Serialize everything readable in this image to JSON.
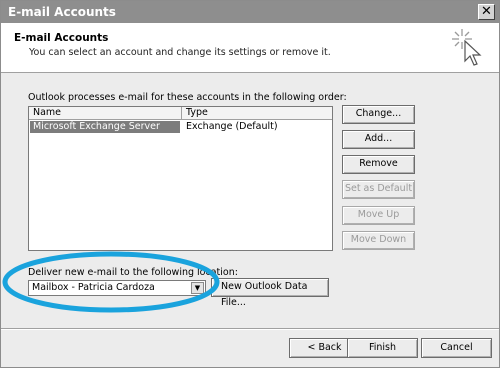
{
  "window": {
    "title": "E-mail Accounts",
    "close_symbol": "✕"
  },
  "header": {
    "title": "E-mail Accounts",
    "subtitle": "You can select an account and change its settings or remove it.",
    "icon": "wizard-sparkle-cursor-icon"
  },
  "accounts": {
    "label": "Outlook processes e-mail for these accounts in the following order:",
    "columns": [
      "Name",
      "Type"
    ],
    "rows": [
      {
        "name": "Microsoft Exchange Server",
        "type": "Exchange (Default)",
        "selected": true
      }
    ]
  },
  "side_buttons": {
    "change": "Change...",
    "add": "Add...",
    "remove": "Remove",
    "set_default": "Set as Default",
    "move_up": "Move Up",
    "move_down": "Move Down"
  },
  "delivery": {
    "label": "Deliver new e-mail to the following location:",
    "selected": "Mailbox - Patricia Cardoza",
    "new_data_file": "New Outlook Data File..."
  },
  "footer": {
    "back": "< Back",
    "finish": "Finish",
    "cancel": "Cancel"
  },
  "colors": {
    "highlight_ellipse": "#1aa3dd",
    "titlebar": "#8e8e8e",
    "selected_row": "#7c7c7c"
  }
}
